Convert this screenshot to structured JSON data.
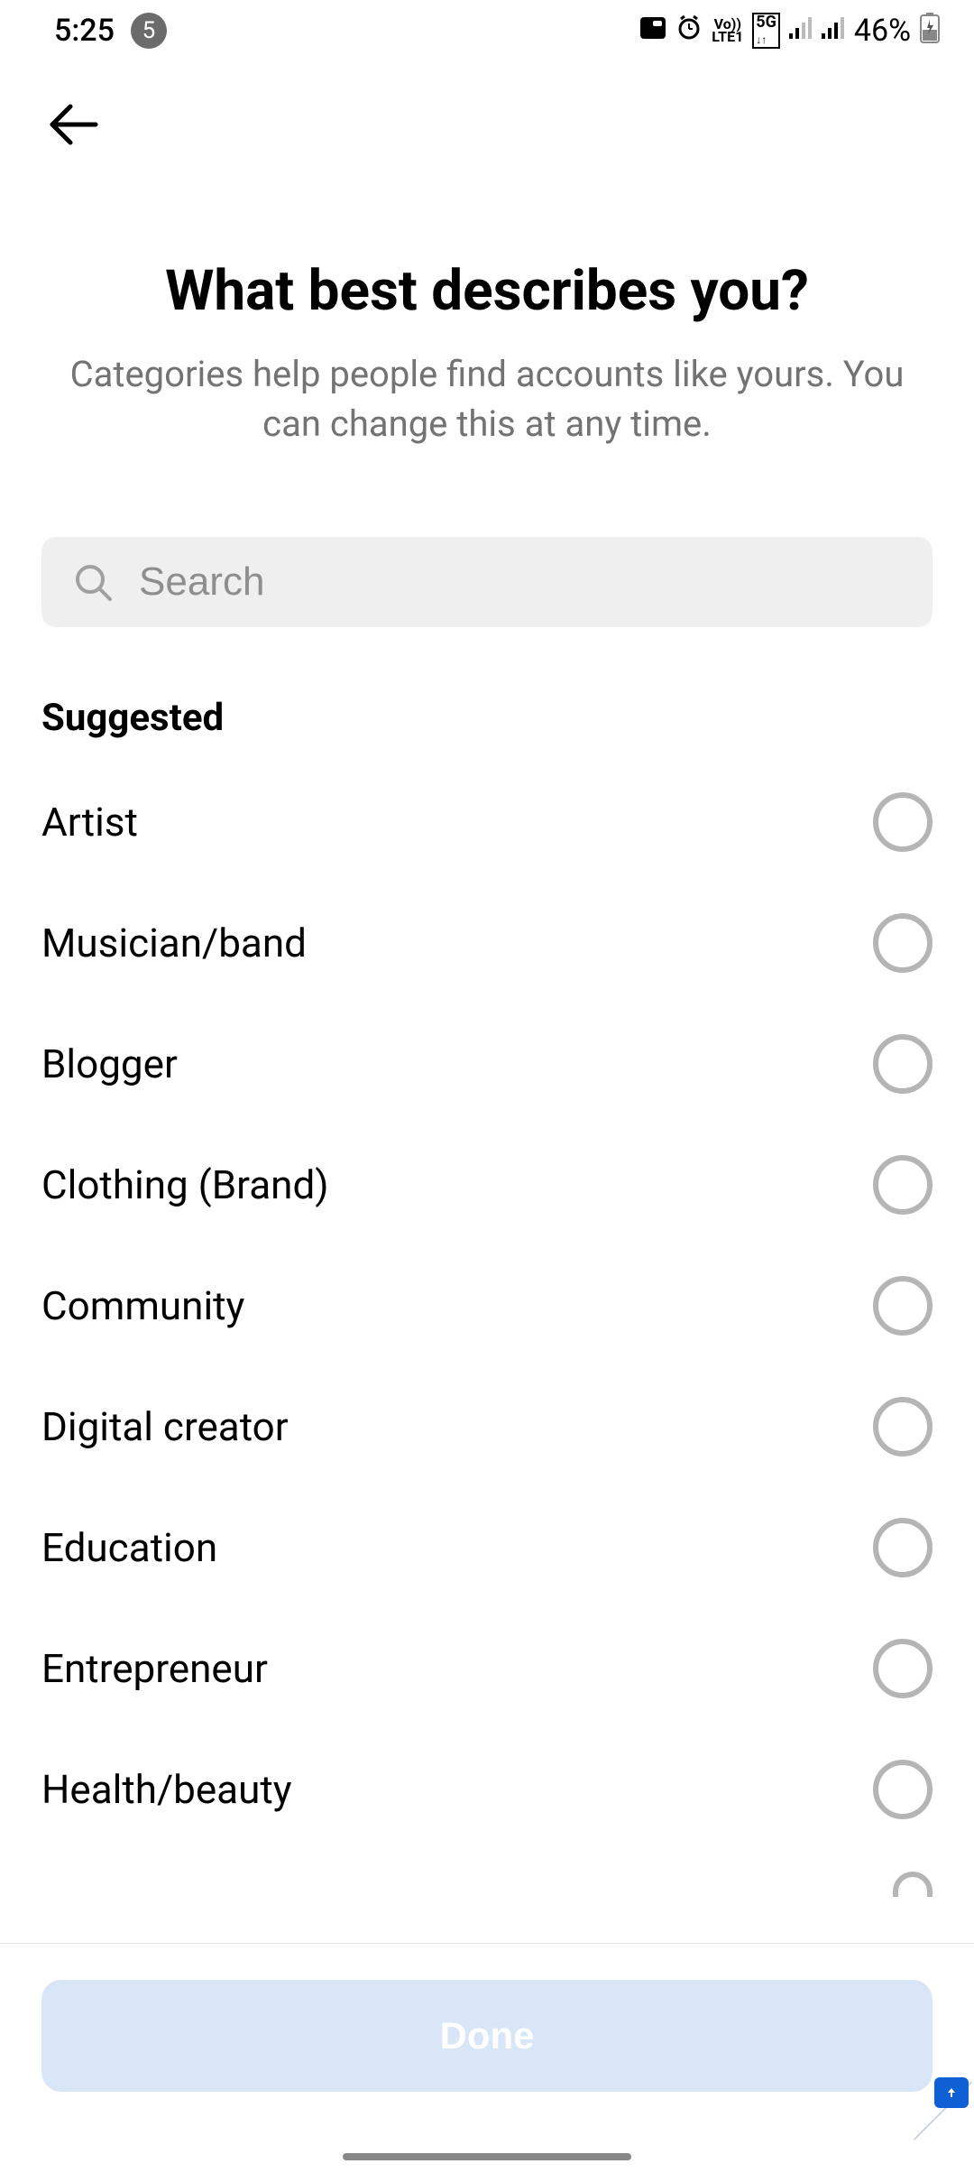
{
  "status": {
    "time": "5:25",
    "notif_count": "5",
    "battery": "46%"
  },
  "header": {
    "title": "What best describes you?",
    "subtitle": "Categories help people find accounts like yours. You can change this at any time."
  },
  "search": {
    "placeholder": "Search"
  },
  "section_label": "Suggested",
  "categories": [
    {
      "label": "Artist"
    },
    {
      "label": "Musician/band"
    },
    {
      "label": "Blogger"
    },
    {
      "label": "Clothing (Brand)"
    },
    {
      "label": "Community"
    },
    {
      "label": "Digital creator"
    },
    {
      "label": "Education"
    },
    {
      "label": "Entrepreneur"
    },
    {
      "label": "Health/beauty"
    }
  ],
  "footer": {
    "done_label": "Done"
  }
}
